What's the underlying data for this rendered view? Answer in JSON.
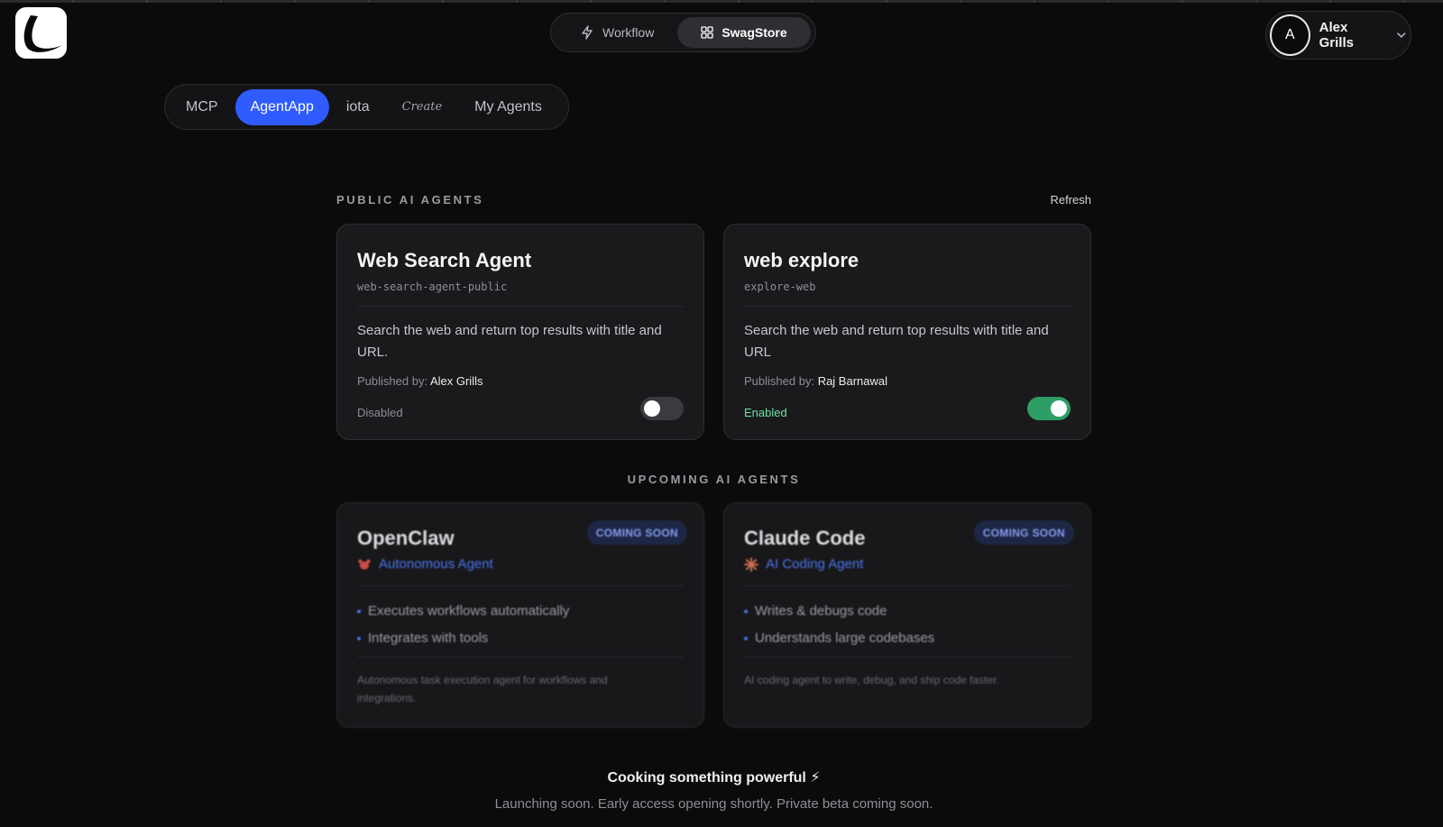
{
  "top_switch": {
    "workflow_label": "Workflow",
    "swagstore_label": "SwagStore",
    "active": "SwagStore"
  },
  "user": {
    "initial": "A",
    "name": "Alex Grills"
  },
  "tabs": [
    {
      "label": "MCP",
      "active": false
    },
    {
      "label": "AgentApp",
      "active": true
    },
    {
      "label": "iota",
      "active": false
    },
    {
      "label": "Create",
      "active": false
    },
    {
      "label": "My Agents",
      "active": false
    }
  ],
  "public": {
    "section_title": "PUBLIC AI AGENTS",
    "refresh_label": "Refresh",
    "published_prefix": "Published by:",
    "agents": [
      {
        "title": "Web Search Agent",
        "slug": "web-search-agent-public",
        "description": "Search the web and return top results with title and URL.",
        "publisher": "Alex Grills",
        "status": "Disabled",
        "enabled": false
      },
      {
        "title": "web explore",
        "slug": "explore-web",
        "description": "Search the web and return top results with title and URL",
        "publisher": "Raj Barnawal",
        "status": "Enabled",
        "enabled": true
      }
    ]
  },
  "upcoming": {
    "section_title": "UPCOMING AI AGENTS",
    "badge_label": "COMING SOON",
    "agents": [
      {
        "title": "OpenClaw",
        "subtitle": "Autonomous Agent",
        "icon": "lobster-icon",
        "features": [
          "Executes workflows automatically",
          "Integrates with tools"
        ],
        "footer": "Autonomous task execution agent for workflows and integrations."
      },
      {
        "title": "Claude Code",
        "subtitle": "AI Coding Agent",
        "icon": "starburst-icon",
        "features": [
          "Writes & debugs code",
          "Understands large codebases"
        ],
        "footer": "AI coding agent to write, debug, and ship code faster."
      }
    ]
  },
  "footer": {
    "title": "Cooking something powerful ⚡",
    "subtitle": "Launching soon. Early access opening shortly. Private beta coming soon."
  },
  "colors": {
    "accent": "#2f5bff",
    "enabled_green": "#2f9e66",
    "background": "#0b0b0c"
  }
}
